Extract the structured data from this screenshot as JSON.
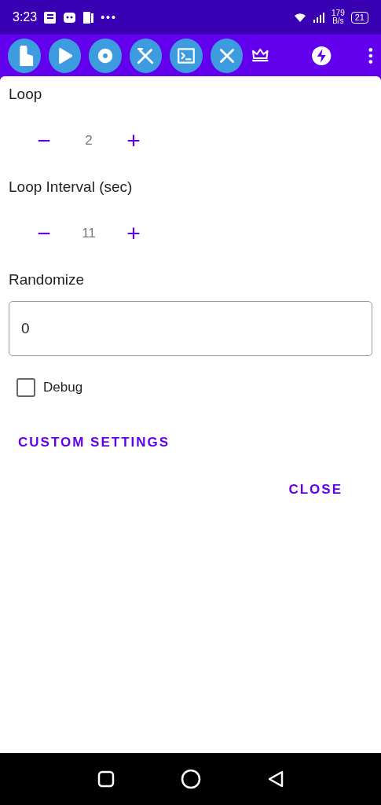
{
  "status_bar": {
    "time": "3:23",
    "more": "•••",
    "speed_value": "179",
    "speed_unit": "B/s",
    "battery": "21"
  },
  "dialog": {
    "steppers": [
      {
        "label": "Loop",
        "minus": "−",
        "value": "2",
        "plus": "+"
      },
      {
        "label": "Loop Interval (sec)",
        "minus": "−",
        "value": "11",
        "plus": "+"
      }
    ],
    "randomize": {
      "label": "Randomize",
      "value": "0"
    },
    "debug": {
      "label": "Debug",
      "checked": false
    },
    "custom_settings": "CUSTOM SETTINGS",
    "close": "CLOSE"
  }
}
